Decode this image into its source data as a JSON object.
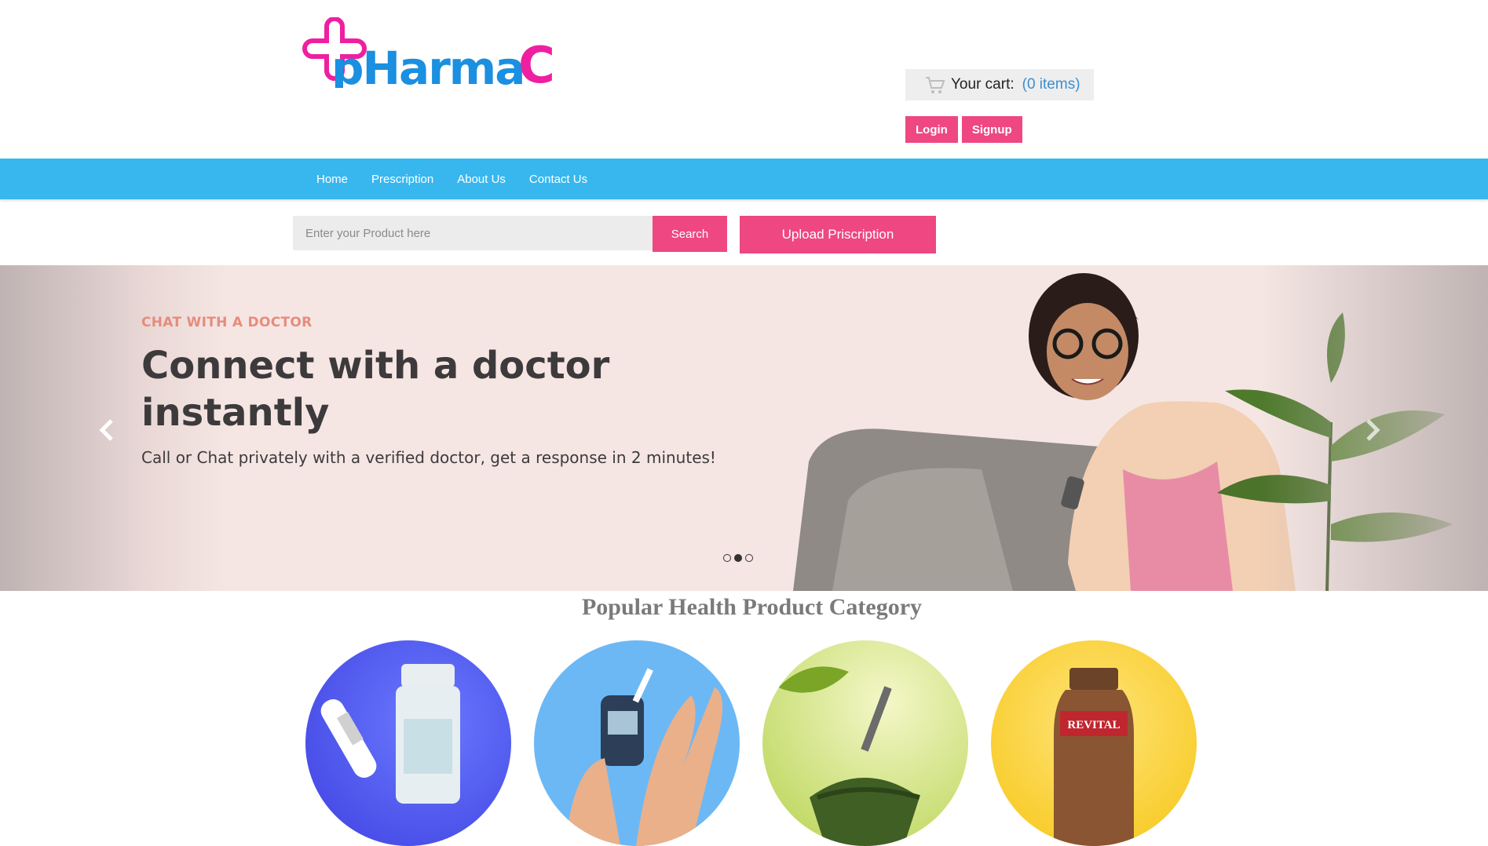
{
  "brand": {
    "logo_text": "pharmaC",
    "colors": {
      "pink": "#ee4782",
      "magenta": "#ee1fa0",
      "blue": "#1b8fe0",
      "nav": "#38b7ef"
    }
  },
  "cart": {
    "label": "Your cart:",
    "count": "(0 items)",
    "icon": "cart-icon"
  },
  "auth": {
    "login": "Login",
    "signup": "Signup"
  },
  "nav": {
    "items": [
      "Home",
      "Prescription",
      "About Us",
      "Contact Us"
    ]
  },
  "search": {
    "placeholder": "Enter your Product here",
    "button": "Search",
    "upload": "Upload Priscription"
  },
  "hero": {
    "eyebrow": "CHAT WITH A DOCTOR",
    "headline": "Connect with a doctor instantly",
    "subtitle": "Call or Chat privately with a verified doctor, get a response in 2 minutes!",
    "slide_count": 3,
    "active_slide": 2
  },
  "categories": {
    "title": "Popular Health Product Category",
    "items": [
      "category-devices-supplements",
      "category-diabetes-care",
      "category-ayurveda",
      "category-vitamins"
    ]
  }
}
